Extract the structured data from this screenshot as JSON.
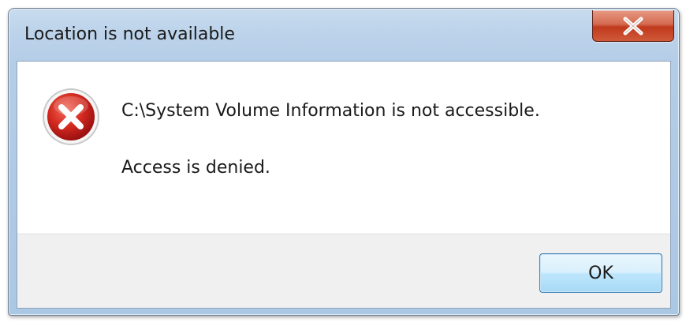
{
  "window": {
    "title": "Location is not available"
  },
  "message": {
    "main": "C:\\System Volume Information is not accessible.",
    "detail": "Access is denied."
  },
  "buttons": {
    "ok_label": "OK"
  },
  "icons": {
    "close": "close-icon",
    "error": "error-icon"
  },
  "colors": {
    "close_button": "#c73a1f",
    "error_icon": "#c41b1b",
    "ok_button_border": "#3c7fb1"
  }
}
